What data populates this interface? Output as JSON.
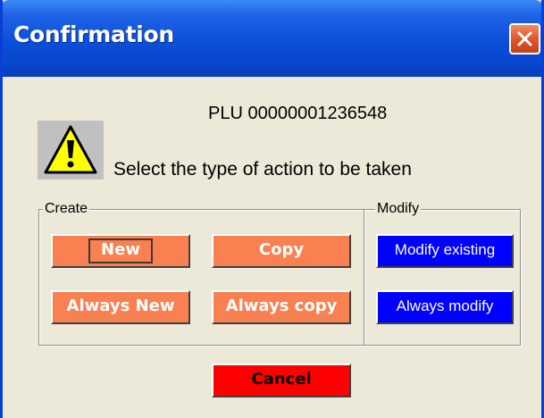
{
  "window": {
    "title": "Confirmation"
  },
  "content": {
    "plu_text": "PLU 00000001236548",
    "message": "Select the type of action to be taken",
    "icon": "warning-icon"
  },
  "create_group": {
    "label": "Create",
    "buttons": {
      "new": "New",
      "copy": "Copy",
      "always_new": "Always New",
      "always_copy": "Always copy"
    }
  },
  "modify_group": {
    "label": "Modify",
    "buttons": {
      "modify_existing": "Modify existing",
      "always_modify": "Always modify"
    }
  },
  "cancel_label": "Cancel",
  "colors": {
    "title_bar": "#0b4fd8",
    "window_bg": "#ece9d8",
    "create_button": "#f98050",
    "modify_button": "#0000ff",
    "cancel_button": "#ff0000"
  }
}
